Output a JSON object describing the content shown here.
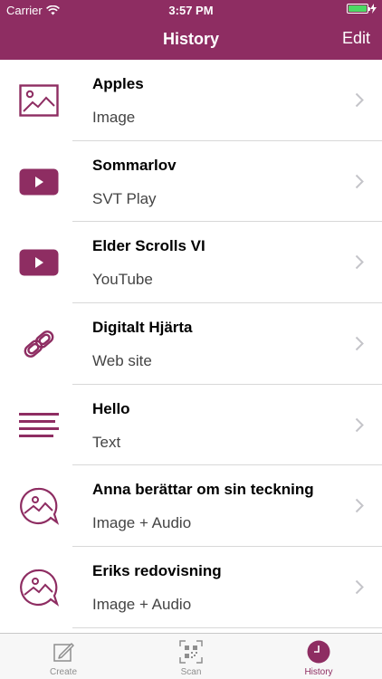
{
  "status_bar": {
    "carrier": "Carrier",
    "time": "3:57 PM",
    "wifi_icon": "wifi-icon",
    "battery_icon": "battery-icon",
    "charging_icon": "charging-bolt-icon"
  },
  "nav": {
    "title": "History",
    "edit_label": "Edit"
  },
  "colors": {
    "brand": "#8e2d62",
    "battery": "#4cd964",
    "tab_inactive": "#8e8e8e"
  },
  "items": [
    {
      "title": "Apples",
      "subtitle": "Image",
      "icon": "image-icon"
    },
    {
      "title": "Sommarlov",
      "subtitle": "SVT Play",
      "icon": "video-play-icon"
    },
    {
      "title": "Elder Scrolls VI",
      "subtitle": "YouTube",
      "icon": "video-play-icon"
    },
    {
      "title": "Digitalt Hjärta",
      "subtitle": "Web site",
      "icon": "link-icon"
    },
    {
      "title": "Hello",
      "subtitle": "Text",
      "icon": "text-lines-icon"
    },
    {
      "title": "Anna berättar om sin teckning",
      "subtitle": "Image + Audio",
      "icon": "image-audio-icon"
    },
    {
      "title": "Eriks redovisning",
      "subtitle": "Image + Audio",
      "icon": "image-audio-icon"
    }
  ],
  "tabs": [
    {
      "label": "Create",
      "icon": "compose-icon",
      "active": false
    },
    {
      "label": "Scan",
      "icon": "qr-scan-icon",
      "active": false
    },
    {
      "label": "History",
      "icon": "clock-icon",
      "active": true
    }
  ]
}
